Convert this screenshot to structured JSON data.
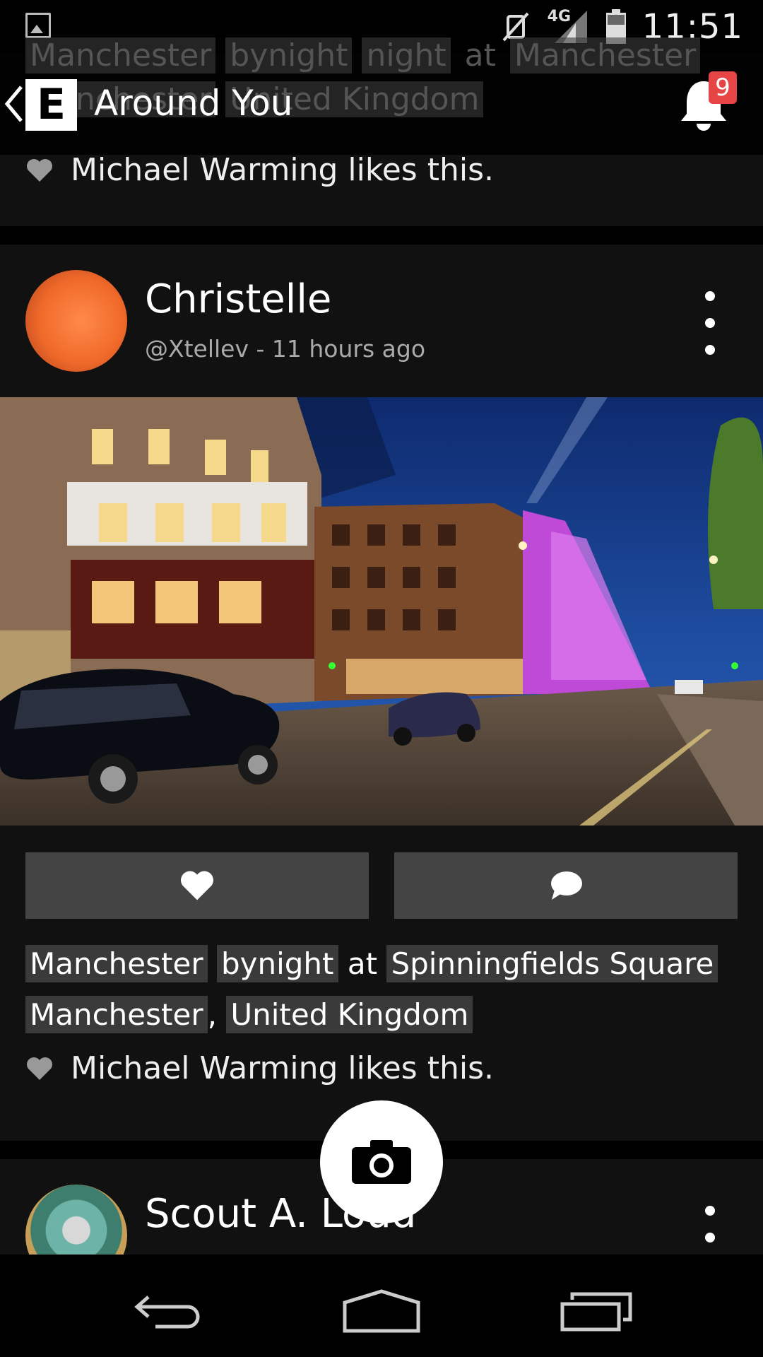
{
  "status_bar": {
    "network": "4G",
    "time": "11:51"
  },
  "toolbar": {
    "app_logo": "E",
    "title": "Around You",
    "notification_count": "9",
    "behind_tags": [
      "Manchester",
      "bynight",
      "night",
      "at",
      "Manchester"
    ],
    "behind_tags_line2": [
      "Manchester",
      "United Kingdom"
    ]
  },
  "previous_post": {
    "likes_text": "Michael Warming likes this."
  },
  "post": {
    "author": "Christelle",
    "meta": "@Xtellev - 11 hours ago",
    "tags": {
      "t1": "Manchester",
      "t2": "bynight",
      "at": "at",
      "place": "Spinningfields Square",
      "city": "Manchester",
      "comma": ",",
      "country": "United Kingdom"
    },
    "likes_text": "Michael Warming likes this."
  },
  "next_post": {
    "author": "Scout A. Loud"
  },
  "colors": {
    "badge": "#e74545",
    "button": "#444444",
    "card": "#111111",
    "tag_bg": "#3a3a3a"
  }
}
